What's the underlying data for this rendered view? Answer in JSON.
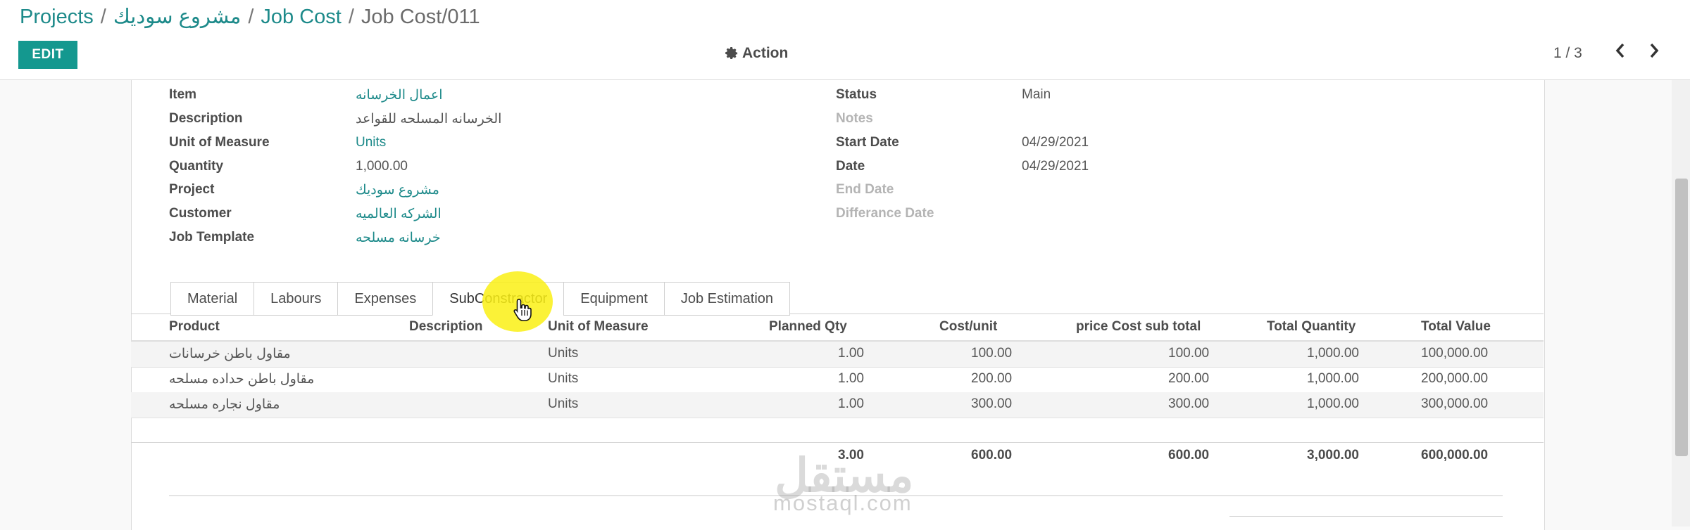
{
  "breadcrumb": {
    "items": [
      "Projects",
      "مشروع سوديك",
      "Job Cost"
    ],
    "current": "Job Cost/011",
    "separator": "/"
  },
  "toolbar": {
    "edit_label": "EDIT",
    "action_label": "Action",
    "pager": "1 / 3",
    "prev_icon": "chevron-left-icon",
    "next_icon": "chevron-right-icon"
  },
  "form": {
    "left": [
      {
        "label": "Item",
        "value": "اعمال الخرسانه",
        "link": true
      },
      {
        "label": "Description",
        "value": "الخرسانه المسلحه للقواعد",
        "link": false
      },
      {
        "label": "Unit of Measure",
        "value": "Units",
        "link": true
      },
      {
        "label": "Quantity",
        "value": "1,000.00",
        "link": false
      },
      {
        "label": "Project",
        "value": "مشروع سوديك",
        "link": true
      },
      {
        "label": "Customer",
        "value": "الشركه العالميه",
        "link": true
      },
      {
        "label": "Job Template",
        "value": "خرسانه مسلحه",
        "link": true
      }
    ],
    "right": [
      {
        "label": "Status",
        "value": "Main",
        "muted": false
      },
      {
        "label": "Notes",
        "value": "",
        "muted": true
      },
      {
        "label": "Start Date",
        "value": "04/29/2021",
        "muted": false
      },
      {
        "label": "Date",
        "value": "04/29/2021",
        "muted": false
      },
      {
        "label": "End Date",
        "value": "",
        "muted": true
      },
      {
        "label": "Differance Date",
        "value": "",
        "muted": true
      }
    ]
  },
  "tabs": [
    "Material",
    "Labours",
    "Expenses",
    "SubConstractor",
    "Equipment",
    "Job Estimation"
  ],
  "active_tab": "SubConstractor",
  "table": {
    "headers": [
      "Product",
      "Description",
      "Unit of Measure",
      "Planned Qty",
      "Cost/unit",
      "price Cost sub total",
      "Total Quantity",
      "Total Value"
    ],
    "rows": [
      [
        "مقاول باطن خرسانات",
        "",
        "Units",
        "1.00",
        "100.00",
        "100.00",
        "1,000.00",
        "100,000.00"
      ],
      [
        "مقاول باطن حداده مسلحه",
        "",
        "Units",
        "1.00",
        "200.00",
        "200.00",
        "1,000.00",
        "200,000.00"
      ],
      [
        "مقاول نجاره مسلحه",
        "",
        "Units",
        "1.00",
        "300.00",
        "300.00",
        "1,000.00",
        "300,000.00"
      ]
    ],
    "totals": [
      "3.00",
      "600.00",
      "600.00",
      "3,000.00",
      "600,000.00"
    ]
  },
  "watermark": {
    "main": "مستقل",
    "sub": "mostaql.com"
  },
  "colors": {
    "accent": "#14988f",
    "link": "#1d8a8a",
    "highlight": "#faf014"
  }
}
